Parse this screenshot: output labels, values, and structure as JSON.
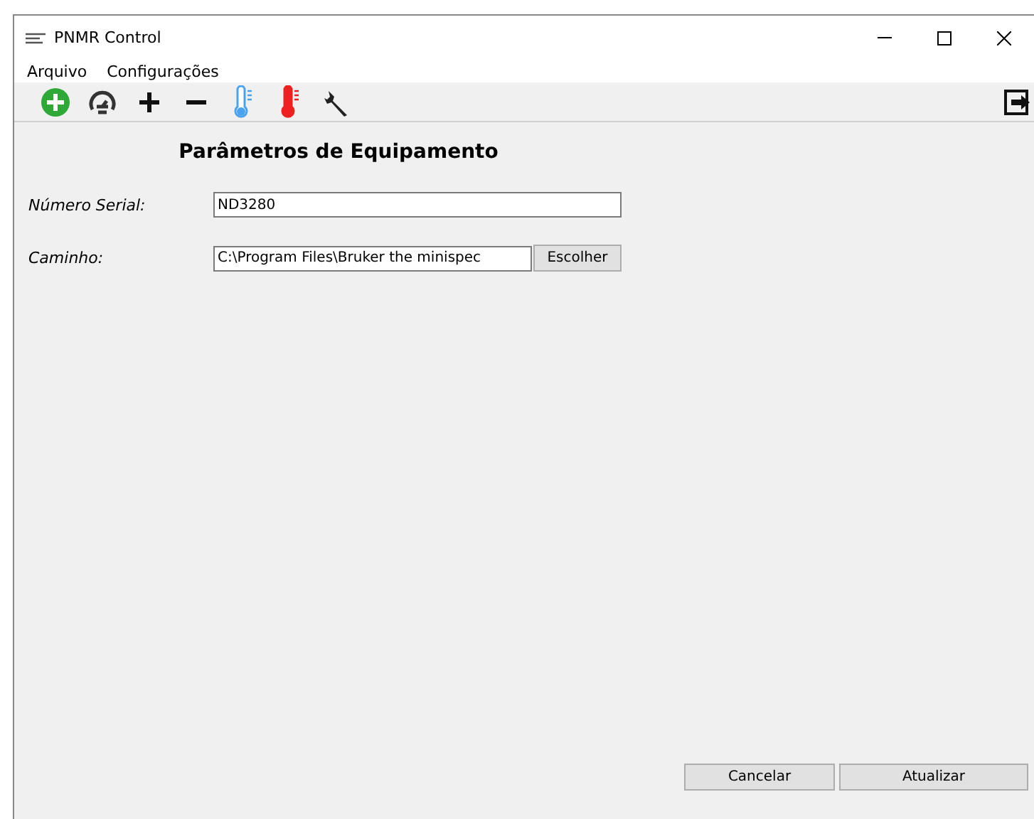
{
  "window": {
    "title": "PNMR Control"
  },
  "menu": [
    "Arquivo",
    "Configurações"
  ],
  "toolbar": {
    "left": [
      {
        "kind": "add"
      },
      {
        "kind": "gauge"
      },
      {
        "kind": "plus"
      },
      {
        "kind": "minus"
      },
      {
        "kind": "thermo_cold"
      },
      {
        "kind": "thermo_hot"
      },
      {
        "kind": "wrench"
      }
    ],
    "right": [
      {
        "kind": "exit"
      }
    ]
  },
  "form": {
    "heading": "Parâmetros de Equipamento",
    "fields": [
      {
        "label": "Número Serial:",
        "value": "ND3280"
      },
      {
        "label": "Caminho:",
        "value": "C:\\Program Files\\Bruker the minispec",
        "button": "Escolher"
      }
    ]
  },
  "buttons": [
    "Cancelar",
    "Atualizar"
  ]
}
